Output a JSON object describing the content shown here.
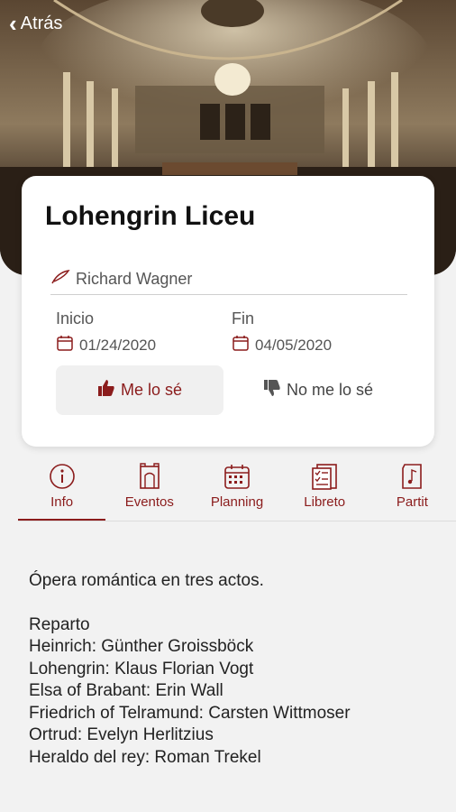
{
  "nav": {
    "back_label": "Atrás"
  },
  "opera": {
    "title": "Lohengrin Liceu",
    "composer": "Richard Wagner",
    "start_label": "Inicio",
    "start_date": "01/24/2020",
    "end_label": "Fin",
    "end_date": "04/05/2020"
  },
  "actions": {
    "know_label": "Me lo sé",
    "dont_know_label": "No me lo sé"
  },
  "tabs": [
    {
      "label": "Info",
      "icon": "info-icon"
    },
    {
      "label": "Eventos",
      "icon": "theater-icon"
    },
    {
      "label": "Planning",
      "icon": "calendar-icon"
    },
    {
      "label": "Libreto",
      "icon": "checklist-icon"
    },
    {
      "label": "Partit",
      "icon": "score-icon"
    }
  ],
  "info": {
    "description": "Ópera romántica en tres actos.",
    "cast_title": "Reparto",
    "cast": [
      "Heinrich: Günther Groissböck",
      "Lohengrin: Klaus Florian Vogt",
      "Elsa of Brabant: Erin Wall",
      "Friedrich of Telramund: Carsten Wittmoser",
      "Ortrud: Evelyn Herlitzius",
      "Heraldo del rey: Roman Trekel"
    ]
  },
  "colors": {
    "accent": "#8b1c1c",
    "background": "#f2f2f2"
  }
}
